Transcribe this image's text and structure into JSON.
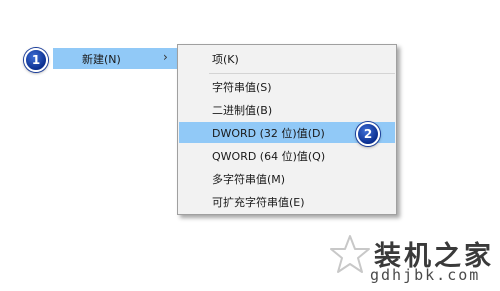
{
  "colors": {
    "highlight": "#91c9f7",
    "menu_background": "#f2f2f2",
    "badge": "#0b2f8f"
  },
  "context_menu": {
    "parent_item": {
      "label": "新建(N)",
      "submenu_indicator": "›"
    }
  },
  "submenu": {
    "items": [
      {
        "label": "项(K)"
      },
      {
        "label": "字符串值(S)"
      },
      {
        "label": "二进制值(B)"
      },
      {
        "label": "DWORD (32 位)值(D)",
        "highlighted": true
      },
      {
        "label": "QWORD (64 位)值(Q)"
      },
      {
        "label": "多字符串值(M)"
      },
      {
        "label": "可扩充字符串值(E)"
      }
    ]
  },
  "step_badges": [
    {
      "number": "1"
    },
    {
      "number": "2"
    }
  ],
  "watermark": {
    "title": "装机之家",
    "domain": "gdhjbk.com",
    "icon": "star-outline-icon"
  }
}
